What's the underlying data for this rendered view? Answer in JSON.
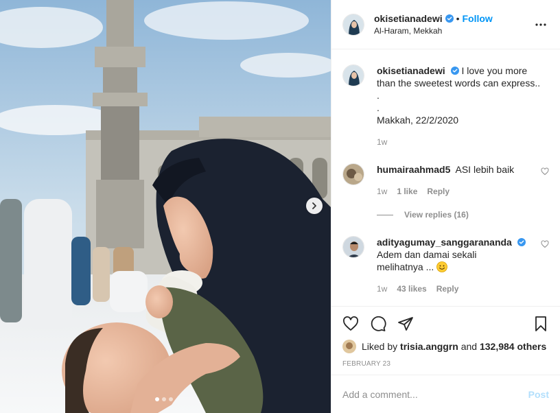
{
  "post": {
    "author": "okisetianadewi",
    "location": "Al-Haram, Mekkah",
    "follow_label": "Follow",
    "separator": "•",
    "caption_lines": [
      "I love you more",
      "than the sweetest words can express..",
      ".",
      ".",
      "Makkah, 22/2/2020"
    ],
    "caption_age": "1w",
    "image_count": 3,
    "current_image": 1
  },
  "comments": [
    {
      "username": "humairaahmad5",
      "text": "ASI lebih baik",
      "age": "1w",
      "likes": "1 like",
      "reply_label": "Reply",
      "view_replies": "View replies (16)"
    },
    {
      "username": "adityagumay_sanggarananda",
      "verified": true,
      "text_lines": [
        "Adem dan damai sekali",
        "melihatnya ..."
      ],
      "emoji": "smiling-face",
      "age": "1w",
      "likes": "43 likes",
      "reply_label": "Reply"
    }
  ],
  "engagement": {
    "liked_by_prefix": "Liked by",
    "liked_by_user": "trisia.anggrn",
    "liked_by_joiner": "and",
    "others": "132,984 others",
    "date": "FEBRUARY 23"
  },
  "add_comment": {
    "placeholder": "Add a comment...",
    "post_label": "Post"
  },
  "colors": {
    "link_blue": "#0095f6",
    "verified_blue": "#3897f0",
    "muted": "#8e8e8e",
    "post_disabled": "#b2dffc"
  }
}
